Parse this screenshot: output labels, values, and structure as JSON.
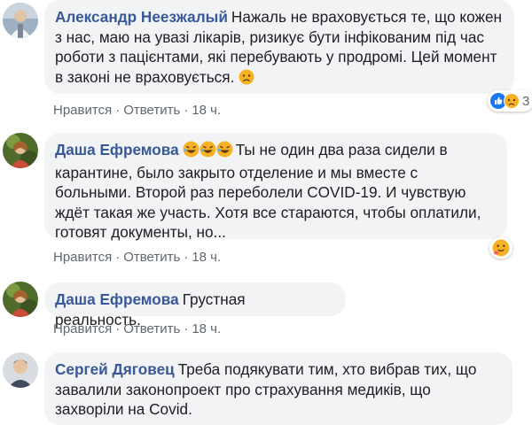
{
  "comments": [
    {
      "author": "Александр Неезжалый",
      "text": "Нажаль не враховується те, що кожен з нас, маю на увазі лікарів, ризикує бути інфікованим під час роботи з пацієнтами, які перебувають у продромі. Цей момент в законі не враховується.",
      "emoji_after": "sad-face",
      "actions": {
        "like": "Нравится",
        "reply": "Ответить",
        "time": "18 ч."
      },
      "reaction": {
        "icons": [
          "like-icon",
          "sad-icon"
        ],
        "count": "3"
      }
    },
    {
      "author": "Даша Ефремова",
      "emoji_before": [
        "rofl-face",
        "rofl-face",
        "rofl-face"
      ],
      "text": "Ты не один два раза сидели в карантине, было закрыто отделение и мы вместе с больными. Второй раз переболели COVID-19. И чувствую ждёт такая же участь. Хотя все стараются, чтобы оплатили, готовят документы, но...",
      "actions": {
        "like": "Нравится",
        "reply": "Ответить",
        "time": "18 ч."
      },
      "reaction": {
        "icons": [
          "hug-icon"
        ],
        "count": ""
      }
    },
    {
      "author": "Даша Ефремова",
      "text": "Грустная реальность.",
      "actions": {
        "like": "Нравится",
        "reply": "Ответить",
        "time": "18 ч."
      }
    },
    {
      "author": "Сергей Дяговец",
      "text": "Треба подякувати тим, хто вибрав тих, що завалили законопроект про страхування медиків, що захворіли на Covid."
    }
  ],
  "colors": {
    "author": "#385898",
    "bubble": "#f2f3f5",
    "meta": "#606770",
    "like": "#1877f2",
    "emoji": "#f7b125"
  }
}
